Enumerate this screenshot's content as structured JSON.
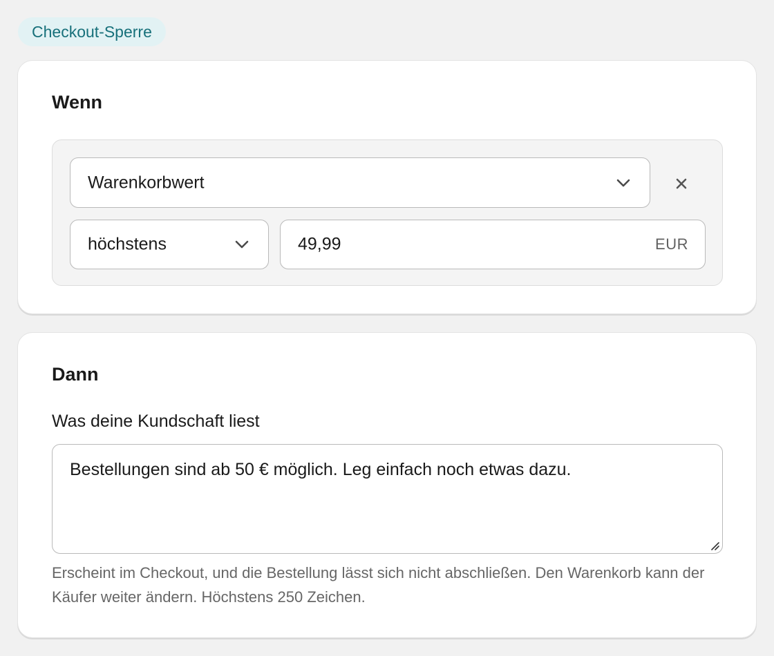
{
  "badge": {
    "label": "Checkout-Sperre"
  },
  "when": {
    "title": "Wenn",
    "field_select": {
      "value": "Warenkorbwert",
      "icon": "chevron-down-icon"
    },
    "remove": {
      "icon": "close-icon",
      "glyph": "×"
    },
    "operator_select": {
      "value": "höchstens",
      "icon": "chevron-down-icon"
    },
    "amount_input": {
      "value": "49,99",
      "unit": "EUR"
    }
  },
  "then": {
    "title": "Dann",
    "message_label": "Was deine Kundschaft liest",
    "message_value": "Bestellungen sind ab 50 € möglich. Leg einfach noch etwas dazu.",
    "help_text": "Erscheint im Checkout, und die Bestellung lässt sich nicht abschließen. Den Warenkorb kann der Käufer weiter ändern. Höchstens 250 Zeichen."
  },
  "colors": {
    "background": "#f1f1f1",
    "badge_bg": "#e2f2f4",
    "badge_text": "#17707a",
    "card_bg": "#ffffff",
    "muted_text": "#666666"
  }
}
